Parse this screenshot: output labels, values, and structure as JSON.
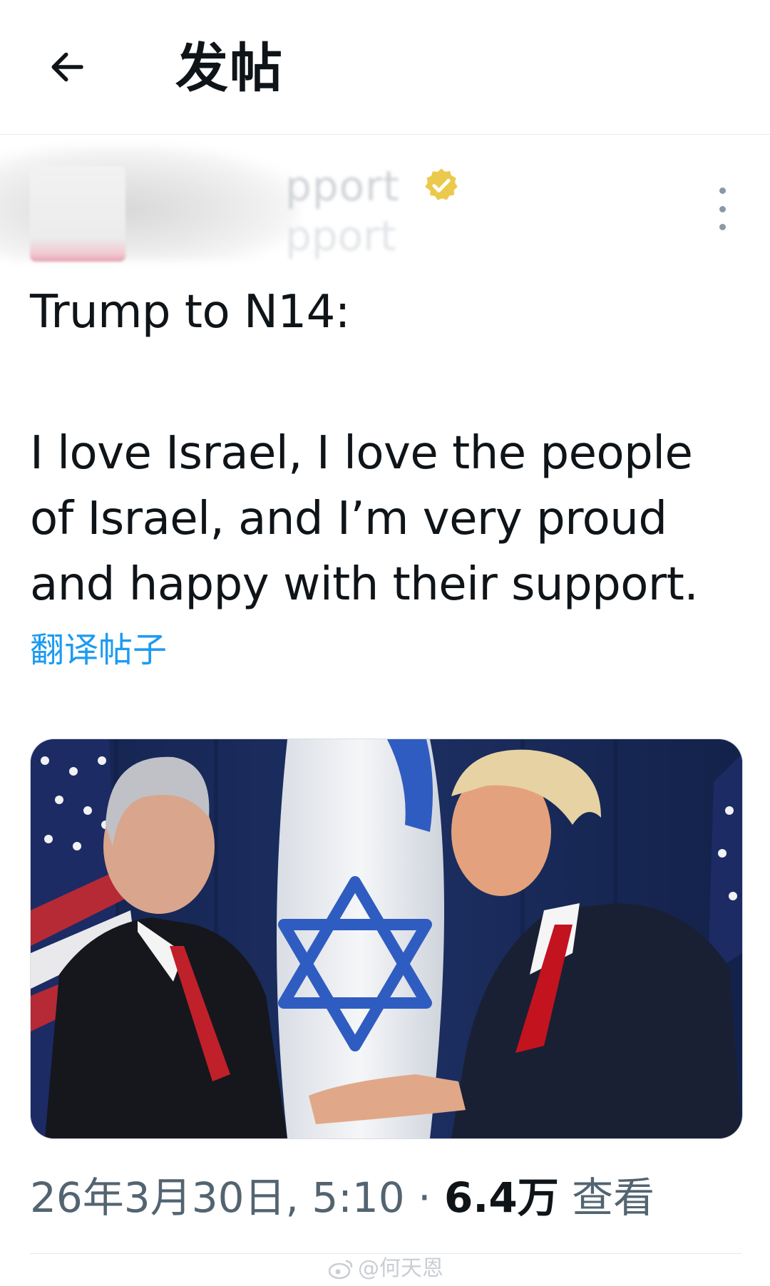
{
  "header": {
    "title": "发帖",
    "back_icon": "arrow-left-icon"
  },
  "author": {
    "name_visible_fragment": "pport",
    "handle_visible_fragment": "pport",
    "verified_badge_color": "#e2b719",
    "more_icon": "more-vertical-icon"
  },
  "post": {
    "heading": "Trump to N14:",
    "body_lines": [
      "I love Israel, I love the people",
      "of Israel, and I’m very proud",
      "and happy with their support."
    ],
    "translate_label": "翻译帖子",
    "image_alt": "photo"
  },
  "meta": {
    "date_time": "26年3月30日, 5:10",
    "separator": " · ",
    "views_count": "6.4万",
    "views_label": " 查看"
  },
  "watermark": {
    "text": "@何天恩"
  },
  "colors": {
    "link": "#1d9bf0",
    "secondary_text": "#536471",
    "primary_text": "#0f1419",
    "divider": "#e6e9ec"
  }
}
